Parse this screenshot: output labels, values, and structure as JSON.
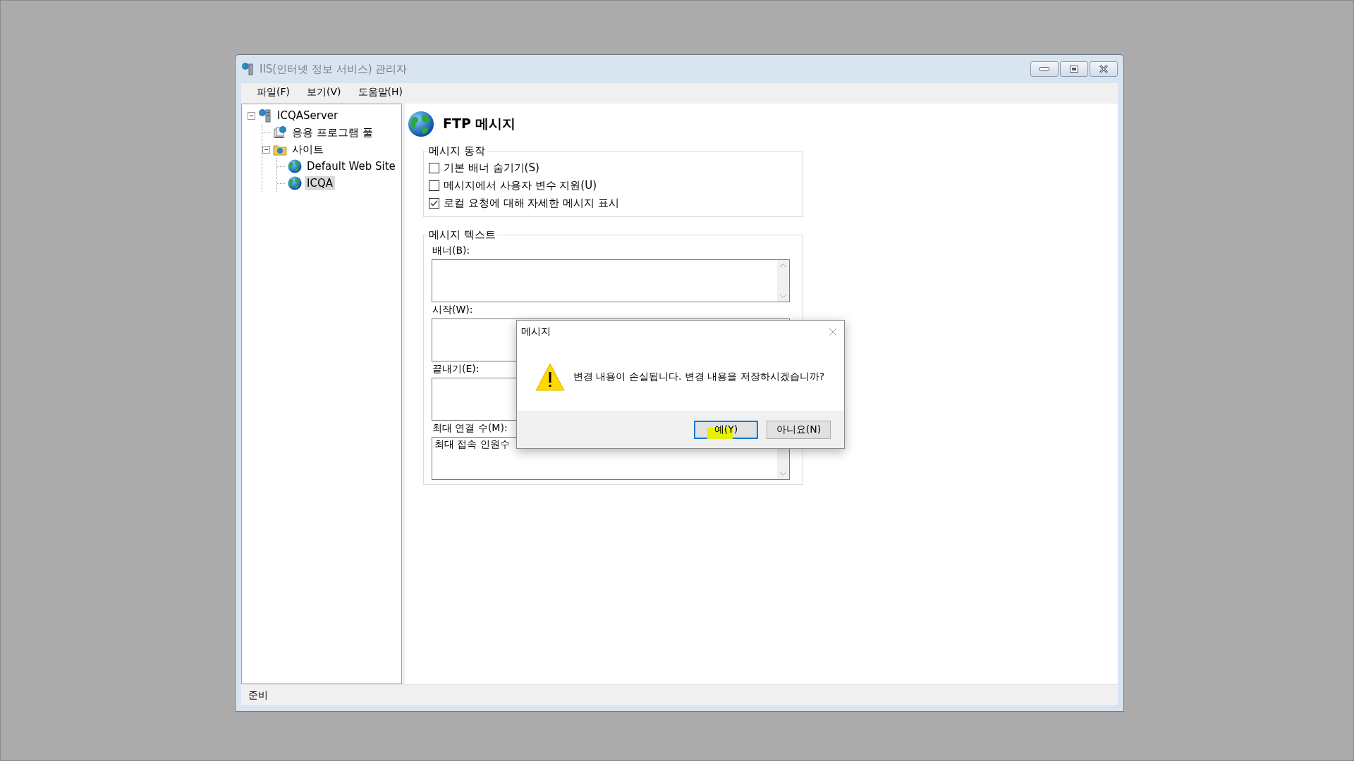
{
  "window": {
    "title": "IIS(인터넷 정보 서비스) 관리자"
  },
  "menu": [
    "파일(F)",
    "보기(V)",
    "도움말(H)"
  ],
  "tree": [
    {
      "label": "ICQAServer",
      "kind": "server",
      "expanded": true,
      "selected": false,
      "children": [
        {
          "label": "응용 프로그램 풀",
          "kind": "pool",
          "selected": false
        },
        {
          "label": "사이트",
          "kind": "folder",
          "expanded": true,
          "selected": false,
          "children": [
            {
              "label": "Default Web Site",
              "kind": "globe",
              "selected": false
            },
            {
              "label": "ICQA",
              "kind": "globe",
              "selected": true
            }
          ]
        }
      ]
    }
  ],
  "page": {
    "title": "FTP 메시지"
  },
  "behavior": {
    "legend": "메시지 동작",
    "options": [
      {
        "label": "기본 배너 숨기기(S)",
        "checked": false
      },
      {
        "label": "메시지에서 사용자 변수 지원(U)",
        "checked": false
      },
      {
        "label": "로컬 요청에 대해 자세한 메시지 표시",
        "checked": true
      }
    ]
  },
  "message_text": {
    "legend": "메시지 텍스트",
    "fields": [
      {
        "label": "배너(B):",
        "scrollbar": true
      },
      {
        "label": "시작(W):"
      },
      {
        "label": "끝내기(E):"
      },
      {
        "label": "최대 연결 수(M):",
        "value": "최대 접속 인원수",
        "scrollbar": true
      }
    ]
  },
  "status_bar": "준비",
  "dialog": {
    "title": "메시지",
    "message": "변경 내용이 손실됩니다. 변경 내용을 저장하시겠습니까?",
    "buttons": [
      {
        "label": "예(Y)",
        "default": true
      },
      {
        "label": "아니요(N)",
        "default": false
      }
    ]
  }
}
